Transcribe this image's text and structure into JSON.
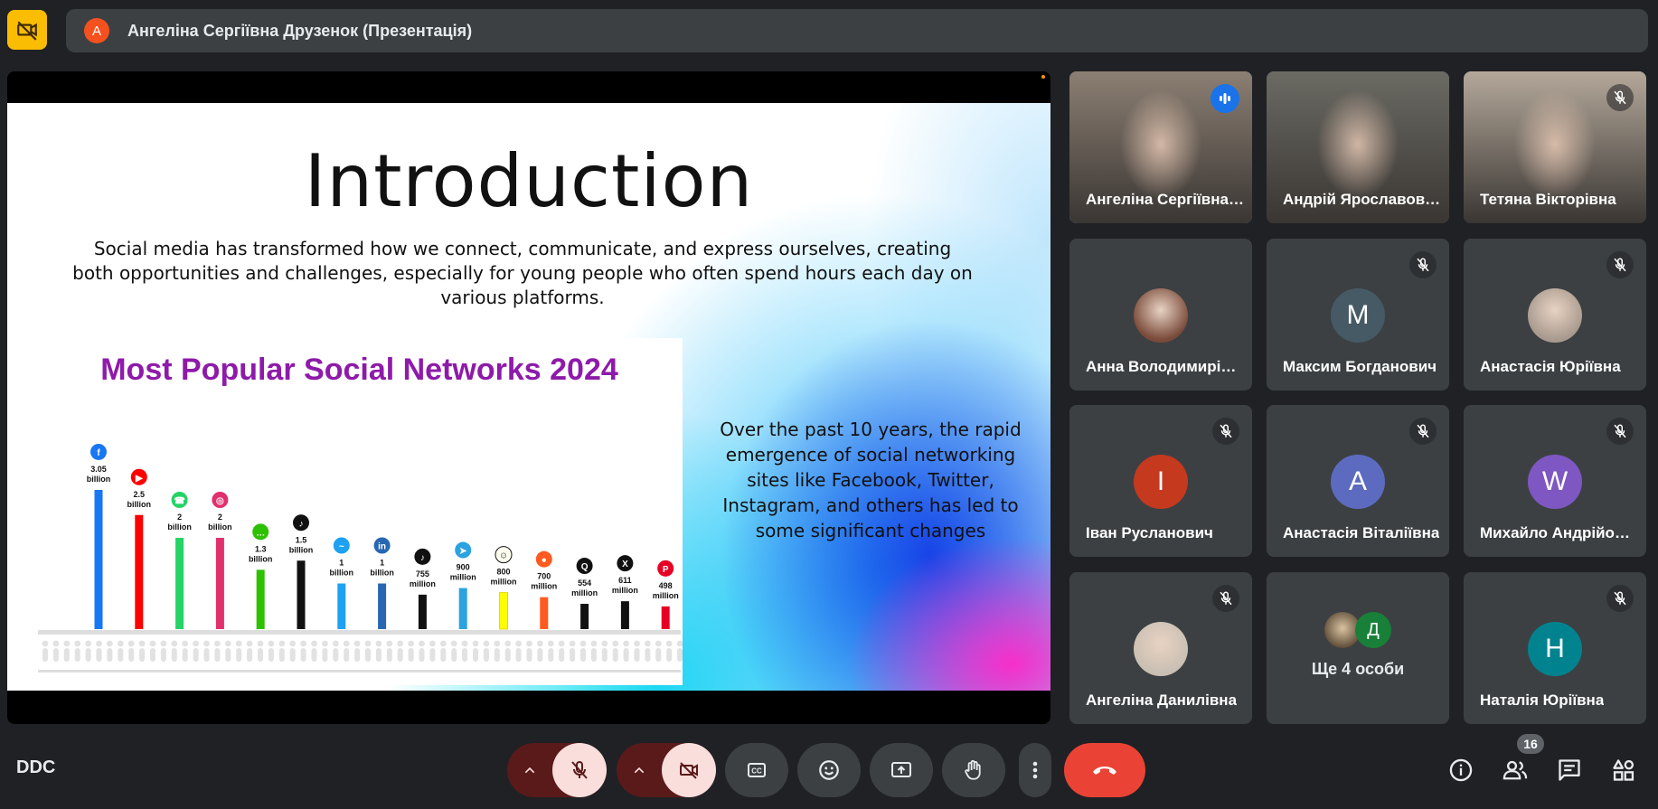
{
  "top_bar": {
    "presenter_initial": "А",
    "presentation_title": "Ангеліна Сергіївна Друзенок (Презентація)"
  },
  "slide": {
    "title": "Introduction",
    "intro_text": "Social media has transformed how we connect, communicate, and express ourselves, creating both opportunities and challenges, especially for young people who often spend hours each day on various platforms.",
    "side_text": "Over the past 10 years, the rapid emergence of social networking sites like Facebook, Twitter, Instagram, and others has led to some significant changes"
  },
  "chart_data": {
    "type": "bar",
    "title": "Most Popular Social Networks 2024",
    "categories": [
      "Facebook",
      "YouTube",
      "WhatsApp",
      "Instagram",
      "WeChat",
      "TikTok",
      "Messenger",
      "LinkedIn",
      "Douyin",
      "Telegram",
      "Snapchat",
      "Kuaishou",
      "QQ",
      "X",
      "Pinterest"
    ],
    "values": [
      3.05,
      2.5,
      2,
      2,
      1.3,
      1.5,
      1,
      1,
      0.755,
      0.9,
      0.8,
      0.7,
      0.554,
      0.611,
      0.498
    ],
    "value_labels": [
      [
        "3.05",
        "billion"
      ],
      [
        "2.5",
        "billion"
      ],
      [
        "2",
        "billion"
      ],
      [
        "2",
        "billion"
      ],
      [
        "1.3",
        "billion"
      ],
      [
        "1.5",
        "billion"
      ],
      [
        "1",
        "billion"
      ],
      [
        "1",
        "billion"
      ],
      [
        "755",
        "million"
      ],
      [
        "900",
        "million"
      ],
      [
        "800",
        "million"
      ],
      [
        "700",
        "million"
      ],
      [
        "554",
        "million"
      ],
      [
        "611",
        "million"
      ],
      [
        "498",
        "million"
      ]
    ],
    "colors": [
      "#1877f2",
      "#ff0000",
      "#25d366",
      "#e1306c",
      "#2dc100",
      "#111111",
      "#1ea1f2",
      "#2867b2",
      "#111111",
      "#2aa3e0",
      "#fffc00",
      "#ff5a1f",
      "#111111",
      "#111111",
      "#e60023"
    ],
    "unit": "users"
  },
  "participants": [
    {
      "name": "Ангеліна Сергіївна Друзенок",
      "type": "video",
      "speaking": true,
      "muted": false,
      "bg": "#8c7f73"
    },
    {
      "name": "Андрій Ярославович",
      "type": "video",
      "speaking": false,
      "muted": false,
      "bg": "#6b6a63"
    },
    {
      "name": "Тетяна Вікторівна",
      "type": "video",
      "speaking": false,
      "muted": true,
      "bg": "#b4a89a"
    },
    {
      "name": "Анна Володимирівна",
      "type": "photo",
      "muted": false,
      "bg": "#7a4a3a"
    },
    {
      "name": "Максим Богданович",
      "type": "initial",
      "initial": "M",
      "muted": true,
      "bg": "#455a64"
    },
    {
      "name": "Анастасія Юріївна",
      "type": "photo",
      "muted": true,
      "bg": "#a89a8e"
    },
    {
      "name": "Іван Русланович",
      "type": "initial",
      "initial": "I",
      "muted": true,
      "bg": "#c5391f"
    },
    {
      "name": "Анастасія Віталіївна",
      "type": "initial",
      "initial": "A",
      "muted": true,
      "bg": "#5c6bc0"
    },
    {
      "name": "Михайло Андрійович",
      "type": "initial",
      "initial": "W",
      "muted": true,
      "bg": "#7e57c2"
    },
    {
      "name": "Ангеліна Данилівна",
      "type": "photo",
      "muted": true,
      "bg": "#c9bfb3"
    },
    {
      "name": "Ще 4 особи",
      "type": "more",
      "muted": false,
      "extra_initial": "Д"
    },
    {
      "name": "Наталія Юріївна",
      "type": "initial",
      "initial": "H",
      "muted": true,
      "bg": "#00838f"
    }
  ],
  "bottom_bar": {
    "meeting_code": "DDC",
    "people_count": "16"
  },
  "colors": {
    "background": "#202124",
    "tile": "#3c4043",
    "end_call": "#ea4335",
    "accent": "#8ab4f8",
    "camera_off_button": "#fbbc04"
  },
  "icons": [
    "camera-off-icon",
    "mic-off-icon",
    "caret-up-icon",
    "captions-icon",
    "emoji-icon",
    "present-icon",
    "raise-hand-icon",
    "more-vert-icon",
    "end-call-icon",
    "info-icon",
    "people-icon",
    "chat-icon",
    "activities-icon"
  ]
}
